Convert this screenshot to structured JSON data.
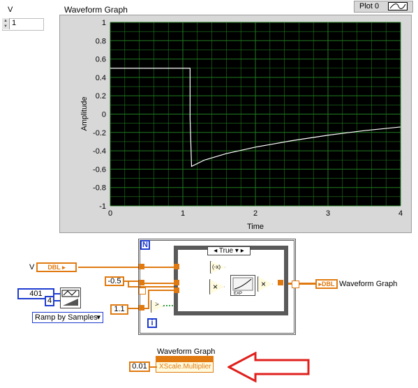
{
  "front_panel": {
    "control_label": "V",
    "control_value": "1",
    "graph_title": "Waveform Graph",
    "legend_label": "Plot 0"
  },
  "chart_data": {
    "type": "line",
    "title": "Waveform Graph",
    "xlabel": "Time",
    "ylabel": "Amplitude",
    "xlim": [
      0,
      4
    ],
    "ylim": [
      -1,
      1
    ],
    "x_ticks": [
      "0",
      "1",
      "2",
      "3",
      "4"
    ],
    "y_ticks": [
      "1",
      "0.8",
      "0.6",
      "0.4",
      "0.2",
      "0",
      "-0.2",
      "-0.4",
      "-0.6",
      "-0.8",
      "-1"
    ],
    "grid": true,
    "series": [
      {
        "x": [
          0,
          1.1,
          1.1,
          1.12,
          1.3,
          1.6,
          2.0,
          2.5,
          3.0,
          3.5,
          4.0
        ],
        "y": [
          0.5,
          0.5,
          -0.05,
          -0.57,
          -0.5,
          -0.43,
          -0.36,
          -0.29,
          -0.23,
          -0.18,
          -0.14
        ],
        "color": "#ffffff"
      }
    ]
  },
  "diagram": {
    "v_label": "V",
    "dbl_tag": "DBL",
    "dbl_out_tag": "DBL",
    "graph_out_label": "Waveform Graph",
    "const_401": "401",
    "const_4": "4",
    "const_neg05": "-0.5",
    "const_11": "1.1",
    "loop_count": "N",
    "loop_index": "i",
    "case_value": "True",
    "ramp_mode": "Ramp by Samples",
    "prop_node_title": "Waveform Graph",
    "prop_name": "XScale.Multiplier",
    "prop_value": "0.01"
  },
  "colors": {
    "plot_bg": "#000000",
    "grid": "#1f7a1f",
    "trace": "#ffffff",
    "wire_orange": "#e07a10",
    "const_blue": "#1d3bd0",
    "arrow_red": "#e0201c"
  }
}
